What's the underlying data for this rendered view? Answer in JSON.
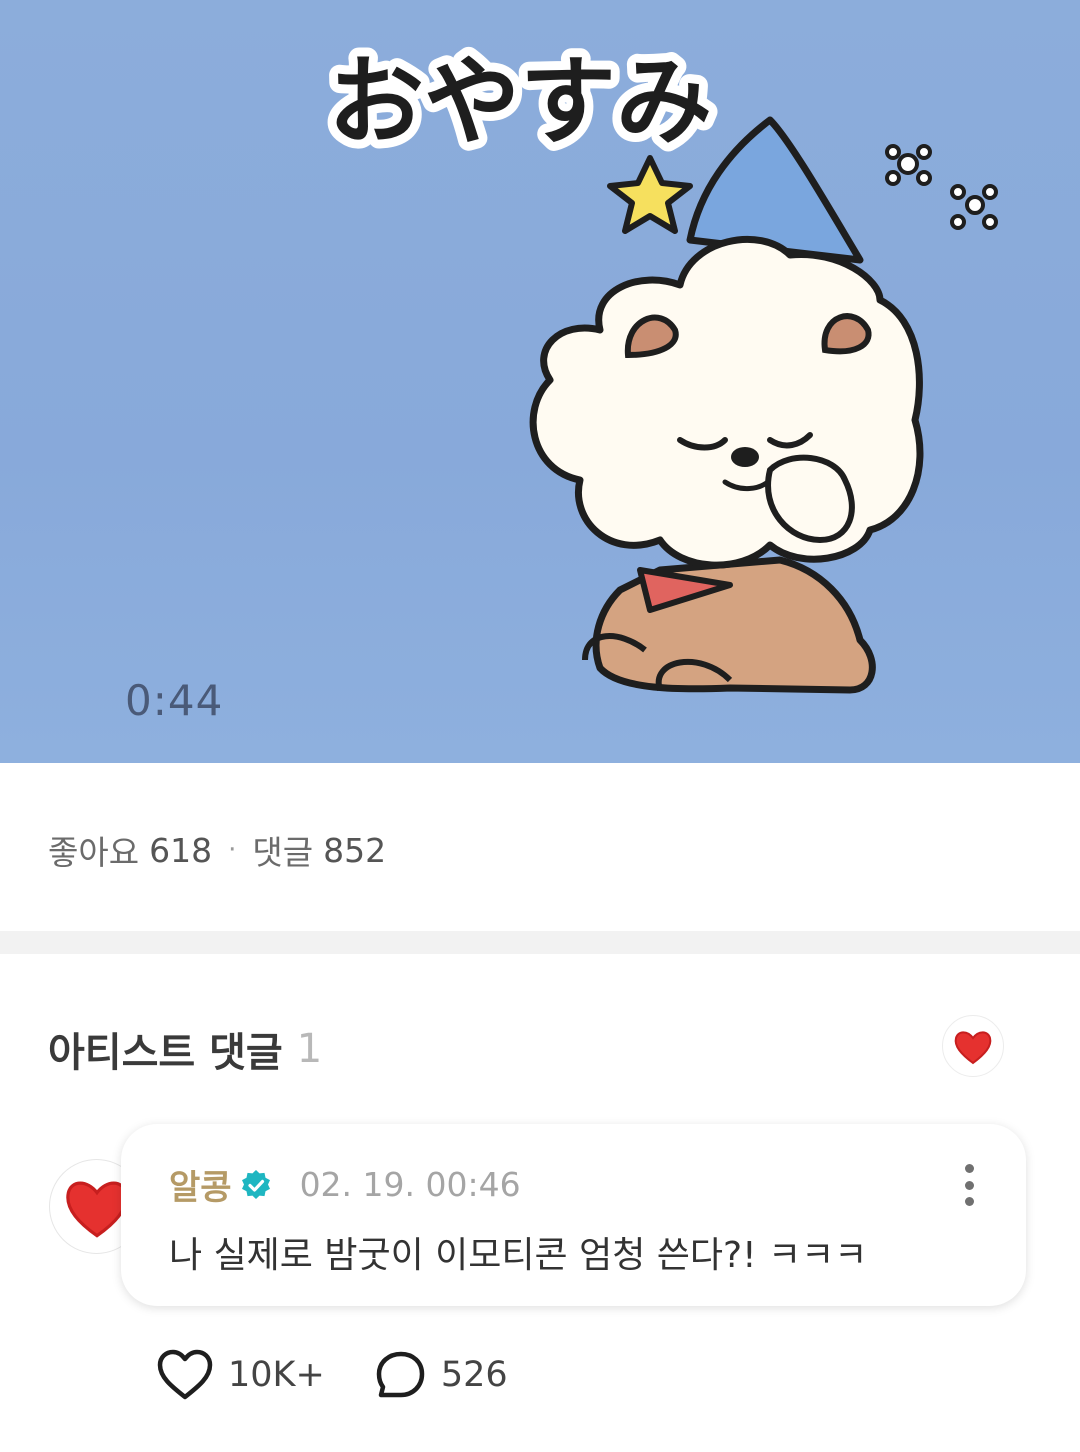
{
  "video": {
    "caption": "おやすみ",
    "timestamp": "0:44",
    "colors": {
      "background": "#8caddb",
      "hat": "#7aa6de",
      "star": "#f6e05e",
      "scarf": "#e0645f",
      "fur": "#fffbf2",
      "body": "#d4a381"
    }
  },
  "stats": {
    "likes_label": "좋아요",
    "likes_count": "618",
    "separator": "·",
    "comments_label": "댓글",
    "comments_count": "852"
  },
  "artist_section": {
    "title": "아티스트 댓글",
    "count": "1",
    "badge_icon": "red-heart-icon"
  },
  "comment": {
    "author": "알콩",
    "verified_icon": "verified-badge-icon",
    "date": "02. 19. 00:46",
    "text": "나 실제로 밤굿이 이모티콘 엄청 쓴다?! ㅋㅋㅋ",
    "more_icon": "more-vertical-icon",
    "likes": "10K+",
    "replies": "526",
    "colors": {
      "author": "#b59a66",
      "verified": "#1fb6c1"
    }
  }
}
